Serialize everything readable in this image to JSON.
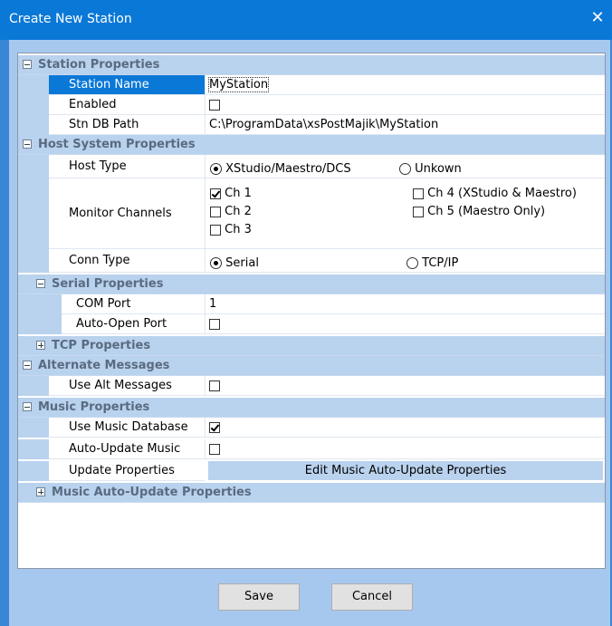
{
  "window": {
    "title": "Create New Station",
    "close_glyph": "✕"
  },
  "categories": {
    "station": "Station Properties",
    "host": "Host System Properties",
    "serial": "Serial Properties",
    "tcp": "TCP Properties",
    "alt": "Alternate Messages",
    "music": "Music Properties",
    "music_auto": "Music Auto-Update Properties"
  },
  "station": {
    "name_label": "Station Name",
    "name_value": "MyStation",
    "enabled_label": "Enabled",
    "enabled": false,
    "path_label": "Stn DB Path",
    "path_value": "C:\\ProgramData\\xsPostMajik\\MyStation"
  },
  "host": {
    "type_label": "Host Type",
    "type_options": [
      "XStudio/Maestro/DCS",
      "Unkown"
    ],
    "type_selected": "XStudio/Maestro/DCS",
    "monitor_label": "Monitor Channels",
    "channels": [
      {
        "label": "Ch 1",
        "checked": true
      },
      {
        "label": "Ch 2",
        "checked": false
      },
      {
        "label": "Ch 3",
        "checked": false
      },
      {
        "label": "Ch 4 (XStudio & Maestro)",
        "checked": false
      },
      {
        "label": "Ch 5 (Maestro Only)",
        "checked": false
      }
    ],
    "conn_label": "Conn Type",
    "conn_options": [
      "Serial",
      "TCP/IP"
    ],
    "conn_selected": "Serial"
  },
  "serial": {
    "com_label": "COM Port",
    "com_value": "1",
    "autoopen_label": "Auto-Open Port",
    "autoopen": false
  },
  "alt": {
    "use_label": "Use Alt Messages",
    "use": false
  },
  "music": {
    "db_label": "Use Music Database",
    "db": true,
    "autoupdate_label": "Auto-Update Music",
    "autoupdate": false,
    "update_label": "Update Properties",
    "edit_button": "Edit Music Auto-Update Properties"
  },
  "buttons": {
    "save": "Save",
    "cancel": "Cancel"
  }
}
